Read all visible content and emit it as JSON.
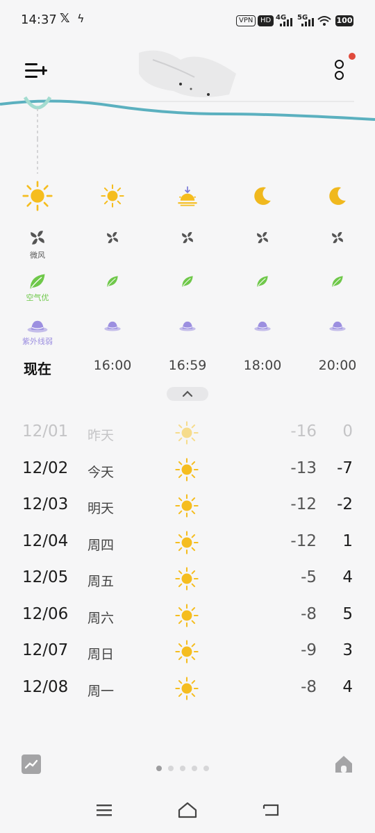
{
  "status_bar": {
    "time": "14:37",
    "vpn": "VPN",
    "hd": "HD",
    "net1": "4G",
    "net2": "5G",
    "battery": "100"
  },
  "hourly": {
    "columns": [
      {
        "time": "现在",
        "weather_icon": "sun-icon",
        "wind_label": "微风",
        "air_label": "空气优",
        "uv_label": "紫外线弱"
      },
      {
        "time": "16:00",
        "weather_icon": "sun-icon",
        "wind_label": "",
        "air_label": "",
        "uv_label": ""
      },
      {
        "time": "16:59",
        "weather_icon": "sunset-icon",
        "wind_label": "",
        "air_label": "",
        "uv_label": ""
      },
      {
        "time": "18:00",
        "weather_icon": "moon-icon",
        "wind_label": "",
        "air_label": "",
        "uv_label": ""
      },
      {
        "time": "20:00",
        "weather_icon": "moon-icon",
        "wind_label": "",
        "air_label": "",
        "uv_label": ""
      }
    ]
  },
  "daily": [
    {
      "date": "12/01",
      "day": "昨天",
      "low": "-16",
      "high": "0"
    },
    {
      "date": "12/02",
      "day": "今天",
      "low": "-13",
      "high": "-7"
    },
    {
      "date": "12/03",
      "day": "明天",
      "low": "-12",
      "high": "-2"
    },
    {
      "date": "12/04",
      "day": "周四",
      "low": "-12",
      "high": "1"
    },
    {
      "date": "12/05",
      "day": "周五",
      "low": "-5",
      "high": "4"
    },
    {
      "date": "12/06",
      "day": "周六",
      "low": "-8",
      "high": "5"
    },
    {
      "date": "12/07",
      "day": "周日",
      "low": "-9",
      "high": "3"
    },
    {
      "date": "12/08",
      "day": "周一",
      "low": "-8",
      "high": "4"
    }
  ],
  "colors": {
    "sun": "#f5bd1f",
    "moon": "#f0b81e",
    "leaf": "#6fc84a",
    "uv": "#9c8fe0",
    "wave": "#5bb0bf"
  }
}
